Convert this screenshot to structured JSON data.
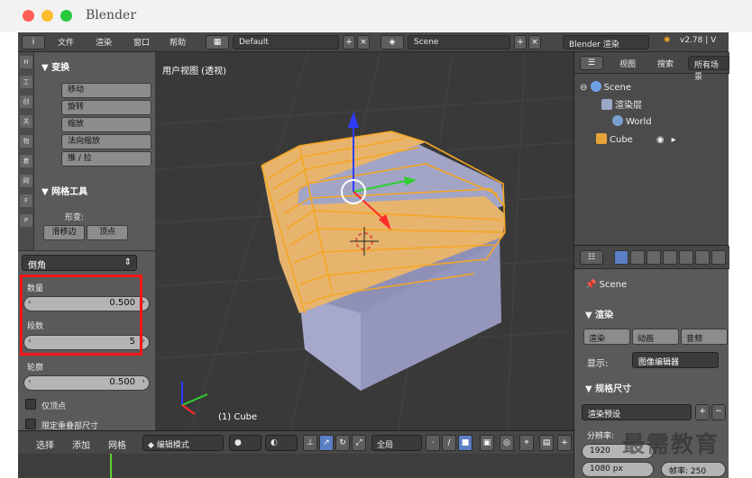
{
  "window": {
    "app_title": "Blender"
  },
  "top_header": {
    "info_icon": "i",
    "menus": [
      "文件",
      "渲染",
      "窗口",
      "帮助"
    ],
    "layout_name": "Default",
    "scene_name": "Scene",
    "engine": "Blender 渲染",
    "version": "v2.78 | V"
  },
  "tool_shelf": {
    "tabs": [
      "H",
      "工",
      "创",
      "关",
      "物",
      "着",
      "网",
      "F",
      "P"
    ],
    "transform_header": "▼ 变换",
    "transform_tools": [
      "移动",
      "旋转",
      "缩放",
      "法向缩放",
      "推 / 拉"
    ],
    "mesh_tools_header": "▼ 网格工具",
    "deform_label": "形变:",
    "slide_edge": "滑移边",
    "vertex": "顶点"
  },
  "operator_panel": {
    "operator_name": "倒角",
    "amount_label": "数量",
    "amount_value": "0.500",
    "segments_label": "段数",
    "segments_value": "5",
    "profile_label": "轮廓",
    "profile_value": "0.500",
    "vertex_only_label": "仅顶点",
    "clamp_label": "限定重叠部尺寸"
  },
  "viewport": {
    "view_name": "用户视图 (透视)",
    "object_info": "(1) Cube"
  },
  "bottom_header": {
    "menus": [
      "选择",
      "添加",
      "网格"
    ],
    "mode": "编辑模式",
    "pivot": "全局"
  },
  "outliner": {
    "view_menu": "视图",
    "search_menu": "搜索",
    "filter": "所有场景",
    "tree": [
      "Scene",
      "渲染层",
      "World",
      "Cube"
    ]
  },
  "properties": {
    "scene_label": "Scene",
    "render_header": "▼ 渲染",
    "render_btn": "渲染",
    "anim_btn": "动画",
    "audio_btn": "音频",
    "display_label": "显示:",
    "display_value": "图像编辑器",
    "dimensions_header": "▼ 规格尺寸",
    "render_preset": "渲染预设",
    "resolution_label": "分辨率:",
    "res_x": "1920",
    "res_y": "1080 px",
    "percent": "帧率: 250"
  },
  "watermark": "最需教育",
  "colors": {
    "selected_edge": "#f5a623",
    "face": "#9fa0c3",
    "highlight_box": "#ff1414"
  }
}
